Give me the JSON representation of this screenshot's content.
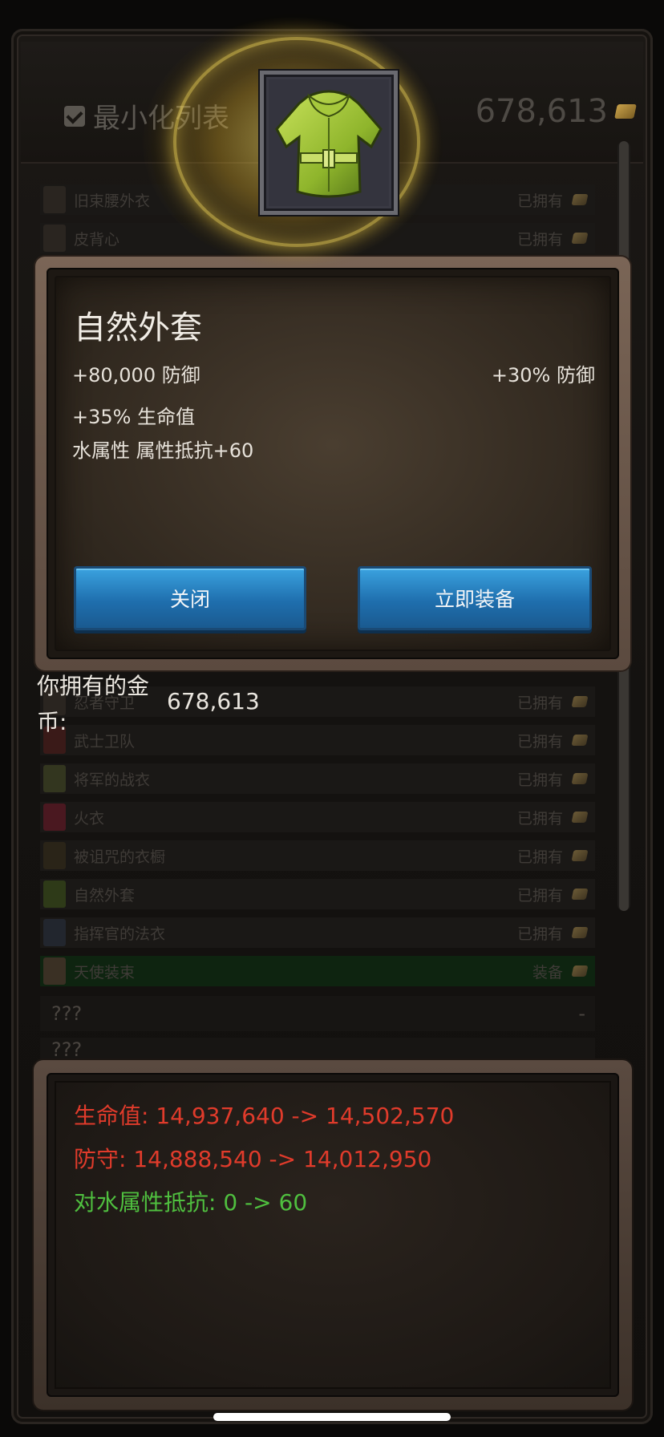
{
  "header": {
    "minimize_label": "最小化列表",
    "gold": "678,613"
  },
  "item_list": [
    {
      "name": "旧束腰外衣",
      "status": "已拥有"
    },
    {
      "name": "皮背心",
      "status": "已拥有"
    },
    {
      "name": "忍者守卫",
      "status": "已拥有"
    },
    {
      "name": "武士卫队",
      "status": "已拥有"
    },
    {
      "name": "将军的战衣",
      "status": "已拥有"
    },
    {
      "name": "火衣",
      "status": "已拥有"
    },
    {
      "name": "被诅咒的衣橱",
      "status": "已拥有"
    },
    {
      "name": "自然外套",
      "status": "已拥有"
    },
    {
      "name": "指挥官的法衣",
      "status": "已拥有"
    },
    {
      "name": "天使装束",
      "status": "装备"
    },
    {
      "name": "???",
      "status": "-"
    },
    {
      "name": "???",
      "status": ""
    }
  ],
  "popup": {
    "title": "自然外套",
    "stat_main": "+80,000 防御",
    "stat_right": "+30% 防御",
    "stat_hp": "+35% 生命值",
    "stat_res": "水属性 属性抵抗+60",
    "close_label": "关闭",
    "equip_label": "立即装备",
    "icon": "green-robe-icon"
  },
  "gold_owned": {
    "label": "你拥有的金币:",
    "value": "678,613"
  },
  "comparison": {
    "hp": "生命值: 14,937,640 -> 14,502,570",
    "defense": "防守: 14,888,540 -> 14,012,950",
    "water_res": "对水属性抵抗: 0 -> 60"
  },
  "colors": {
    "decrease": "#e03b2b",
    "increase": "#4fbf3f",
    "button": "#2a85c8"
  }
}
